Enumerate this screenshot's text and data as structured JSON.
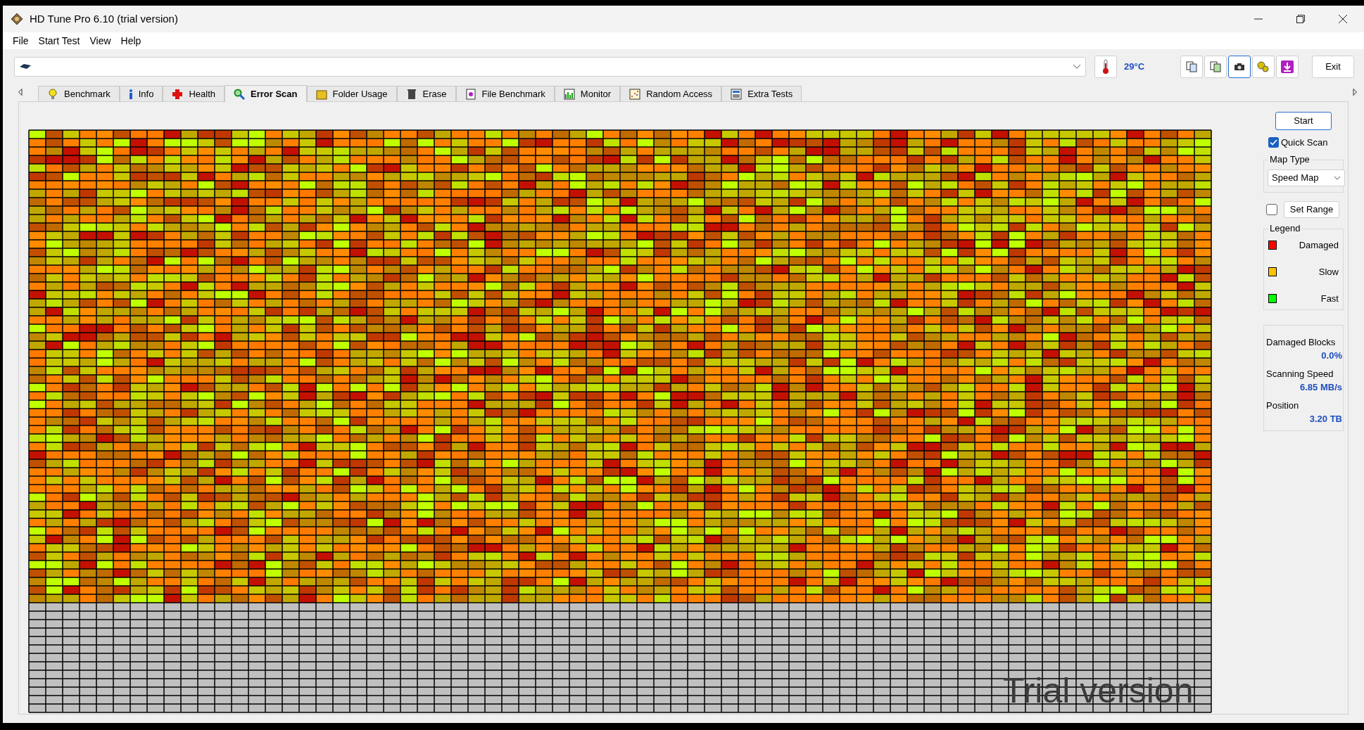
{
  "window": {
    "title": "HD Tune Pro 6.10 (trial version)"
  },
  "menu": [
    "File",
    "Start Test",
    "View",
    "Help"
  ],
  "temperature": "29°C",
  "exit_button": "Exit",
  "tabs": [
    {
      "label": "Benchmark",
      "selected": false
    },
    {
      "label": "Info",
      "selected": false
    },
    {
      "label": "Health",
      "selected": false
    },
    {
      "label": "Error Scan",
      "selected": true
    },
    {
      "label": "Folder Usage",
      "selected": false
    },
    {
      "label": "Erase",
      "selected": false
    },
    {
      "label": "File Benchmark",
      "selected": false
    },
    {
      "label": "Monitor",
      "selected": false
    },
    {
      "label": "Random Access",
      "selected": false
    },
    {
      "label": "Extra Tests",
      "selected": false
    }
  ],
  "side_panel": {
    "start_button": "Start",
    "quick_scan": {
      "label": "Quick Scan",
      "checked": true
    },
    "map_type": {
      "title": "Map Type",
      "value": "Speed Map"
    },
    "range": {
      "checked": false,
      "button": "Set Range"
    },
    "legend": {
      "title": "Legend",
      "items": [
        {
          "label": "Damaged",
          "color": "#ff0000"
        },
        {
          "label": "Slow",
          "color": "#ffc000"
        },
        {
          "label": "Fast",
          "color": "#00ff00"
        }
      ]
    },
    "stats": [
      {
        "label": "Damaged Blocks",
        "value": "0.0%"
      },
      {
        "label": "Scanning Speed",
        "value": "6.85 MB/s"
      },
      {
        "label": "Position",
        "value": "3.20 TB"
      }
    ]
  },
  "overlay_text": "Trial version"
}
